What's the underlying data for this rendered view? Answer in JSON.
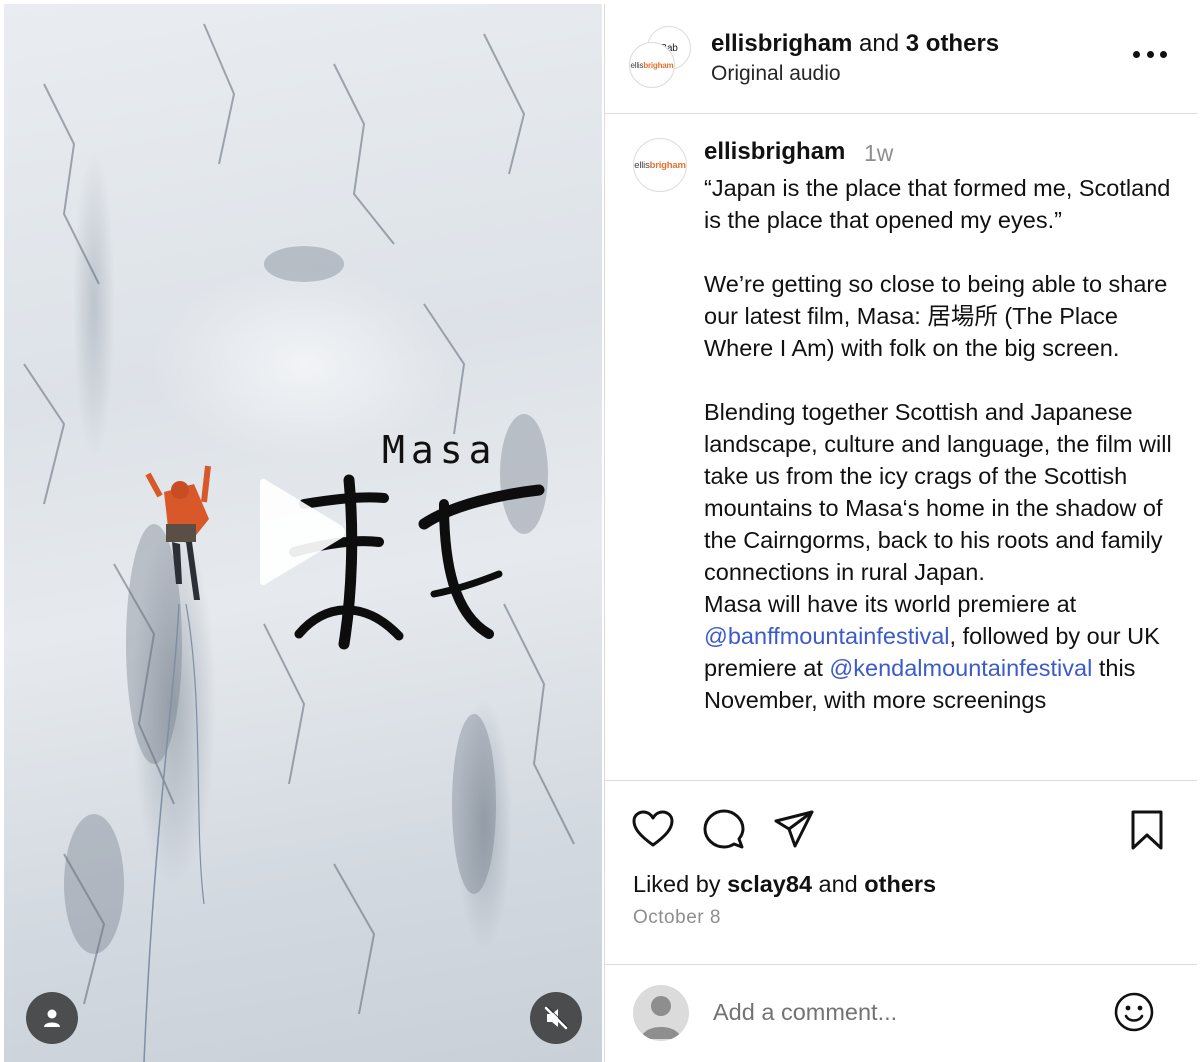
{
  "video": {
    "title_latin": "Masa",
    "play_label": "Play video",
    "profile_button": "Tagged people",
    "mute_button": "Muted"
  },
  "header": {
    "author": "ellisbrigham",
    "and_text": " and ",
    "others": "3 others",
    "audio": "Original audio",
    "logo_prefix": "ellis",
    "logo_suffix": "brigham",
    "second_avatar_text": "Bab"
  },
  "caption": {
    "username": "ellisbrigham",
    "time_ago": "1w",
    "paragraphs": [
      "“Japan is the place that formed me, Scotland is the place that opened my eyes.”",
      "We’re getting so close to being able to share our latest film, Masa: 居場所 (The Place Where I Am) with folk on the big screen.",
      "Blending together Scottish and Japanese landscape, culture and language, the film will take us from the icy crags of the Scottish mountains to Masa‘s home in the shadow of the Cairngorms, back to his roots and family connections in rural Japan."
    ],
    "premiere_text_1": "Masa will have its world premiere at ",
    "mention_1": "@banffmountainfestival",
    "premiere_text_2": ", followed by our UK premiere at ",
    "mention_2": "@kendalmountainfestival",
    "premiere_text_3": " this November, with more screenings"
  },
  "actions": {
    "liked_by_prefix": "Liked by ",
    "liked_by_user": "sclay84",
    "and_text": " and ",
    "others": "others",
    "date": "October 8"
  },
  "comment": {
    "placeholder": "Add a comment..."
  }
}
